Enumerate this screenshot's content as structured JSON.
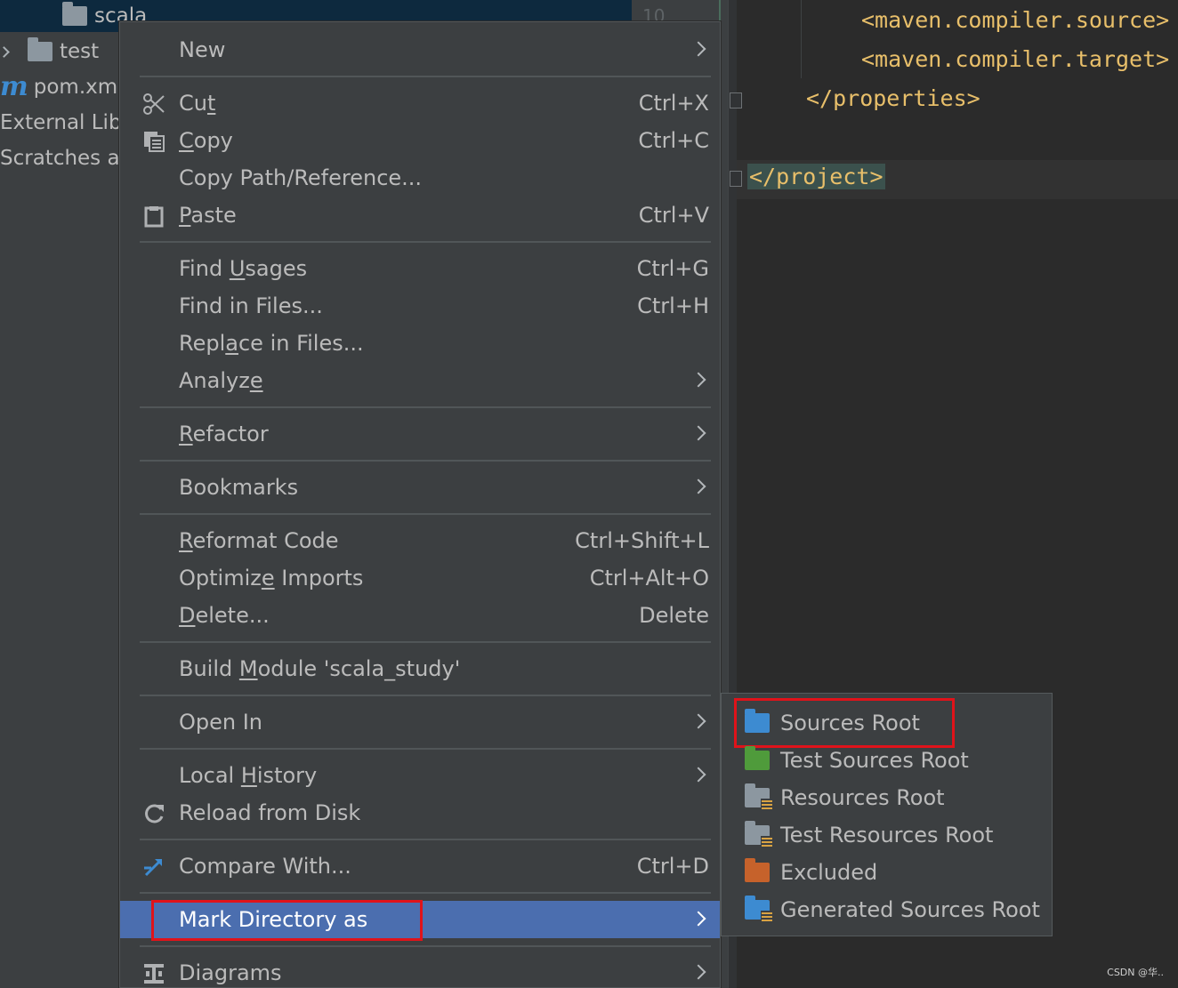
{
  "tree": {
    "items": [
      {
        "label": "scala",
        "type": "folder",
        "selected": true
      },
      {
        "label": "test",
        "type": "folder",
        "collapsed": true
      },
      {
        "label": "pom.xml",
        "type": "maven-file"
      },
      {
        "label": "External Libr",
        "type": "libraries"
      },
      {
        "label": "Scratches ar",
        "type": "scratches"
      }
    ],
    "line_number": "10"
  },
  "editor": {
    "lines": [
      "<maven.compiler.source>",
      "<maven.compiler.target>",
      "</properties>",
      "</project>"
    ]
  },
  "context_menu": {
    "groups": [
      [
        {
          "label": "New",
          "mnemonic_index": -1,
          "submenu": true
        }
      ],
      [
        {
          "label": "Cut",
          "mnemonic_index": 2,
          "shortcut": "Ctrl+X",
          "icon": "scissors-icon"
        },
        {
          "label": "Copy",
          "mnemonic_index": 0,
          "shortcut": "Ctrl+C",
          "icon": "copy-icon"
        },
        {
          "label": "Copy Path/Reference...",
          "mnemonic_index": -1
        },
        {
          "label": "Paste",
          "mnemonic_index": 0,
          "shortcut": "Ctrl+V",
          "icon": "clipboard-icon"
        }
      ],
      [
        {
          "label": "Find Usages",
          "mnemonic_index": 5,
          "shortcut": "Ctrl+G"
        },
        {
          "label": "Find in Files...",
          "mnemonic_index": -1,
          "shortcut": "Ctrl+H"
        },
        {
          "label": "Replace in Files...",
          "mnemonic_index": 4
        },
        {
          "label": "Analyze",
          "mnemonic_index": 6,
          "submenu": true
        }
      ],
      [
        {
          "label": "Refactor",
          "mnemonic_index": 0,
          "submenu": true
        }
      ],
      [
        {
          "label": "Bookmarks",
          "mnemonic_index": -1,
          "submenu": true
        }
      ],
      [
        {
          "label": "Reformat Code",
          "mnemonic_index": 0,
          "shortcut": "Ctrl+Shift+L"
        },
        {
          "label": "Optimize Imports",
          "mnemonic_index": 7,
          "shortcut": "Ctrl+Alt+O"
        },
        {
          "label": "Delete...",
          "mnemonic_index": 0,
          "shortcut": "Delete"
        }
      ],
      [
        {
          "label": "Build Module 'scala_study'",
          "mnemonic_index": 6
        }
      ],
      [
        {
          "label": "Open In",
          "mnemonic_index": -1,
          "submenu": true
        }
      ],
      [
        {
          "label": "Local History",
          "mnemonic_index": 6,
          "submenu": true
        },
        {
          "label": "Reload from Disk",
          "mnemonic_index": -1,
          "icon": "reload-icon"
        }
      ],
      [
        {
          "label": "Compare With...",
          "mnemonic_index": -1,
          "shortcut": "Ctrl+D",
          "icon": "compare-icon"
        }
      ],
      [
        {
          "label": "Mark Directory as",
          "mnemonic_index": -1,
          "submenu": true,
          "active": true
        }
      ],
      [
        {
          "label": "Diagrams",
          "mnemonic_index": -1,
          "submenu": true,
          "icon": "diagram-icon"
        }
      ]
    ]
  },
  "submenu": {
    "items": [
      {
        "label": "Sources Root",
        "color": "#3d8bd1",
        "highlighted": true
      },
      {
        "label": "Test Sources Root",
        "color": "#4f9b3b"
      },
      {
        "label": "Resources Root",
        "color": "#8c97a0",
        "badge": "resources"
      },
      {
        "label": "Test Resources Root",
        "color": "#8c97a0",
        "badge": "test-resources"
      },
      {
        "label": "Excluded",
        "color": "#c6622b"
      },
      {
        "label": "Generated Sources Root",
        "color": "#3d8bd1",
        "badge": "generated"
      }
    ]
  },
  "colors": {
    "menu_bg": "#3c3f41",
    "selection": "#4b6eaf",
    "highlight_box": "#e0131a",
    "editor_bg": "#2b2b2b",
    "xml_tag": "#e8bf6a"
  },
  "watermark": "CSDN @华.."
}
